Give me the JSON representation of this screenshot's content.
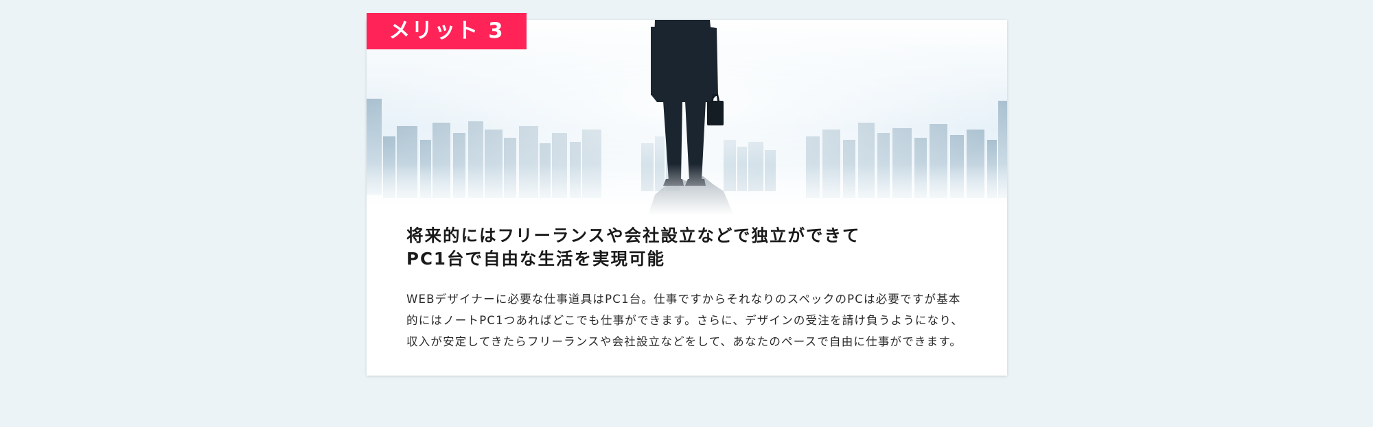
{
  "badge": {
    "label": "メリット 3",
    "color": "#ff2358"
  },
  "hero": {
    "image": "businessman-overlooking-city-skyline"
  },
  "card": {
    "title_line1": "将来的にはフリーランスや会社設立などで独立ができて",
    "title_line2": "PC1台で自由な生活を実現可能",
    "body": "WEBデザイナーに必要な仕事道具はPC1台。仕事ですからそれなりのスペックのPCは必要ですが基本的にはノートPC1つあればどこでも仕事ができます。さらに、デザインの受注を請け負うようになり、収入が安定してきたらフリーランスや会社設立などをして、あなたのペースで自由に仕事ができます。"
  },
  "colors": {
    "page_background": "#ebf3f7",
    "card_background": "#ffffff",
    "accent": "#ff2358"
  }
}
